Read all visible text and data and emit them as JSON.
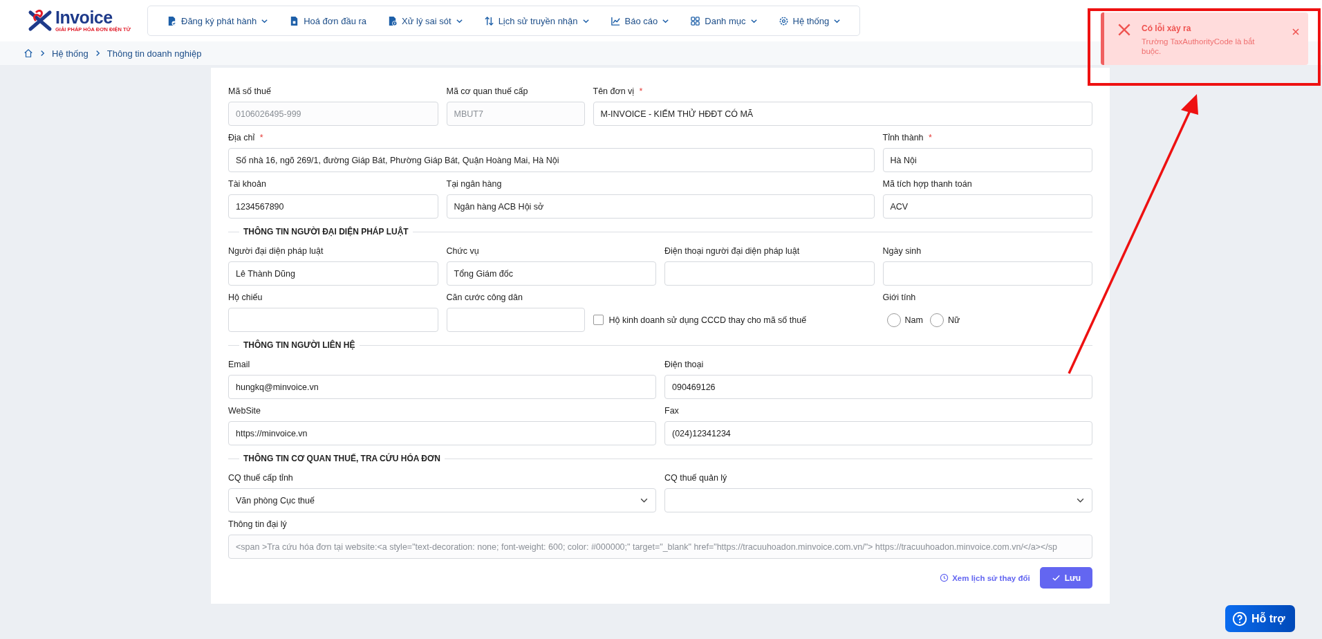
{
  "logo": {
    "brand": "Invoice",
    "tagline": "GIẢI PHÁP HÓA ĐƠN ĐIỆN TỬ"
  },
  "nav": [
    {
      "label": "Đăng ký phát hành",
      "dropdown": true
    },
    {
      "label": "Hoá đơn đầu ra",
      "dropdown": false
    },
    {
      "label": "Xử lý sai sót",
      "dropdown": true
    },
    {
      "label": "Lịch sử truyền nhận",
      "dropdown": true
    },
    {
      "label": "Báo cáo",
      "dropdown": true
    },
    {
      "label": "Danh mục",
      "dropdown": true
    },
    {
      "label": "Hệ thống",
      "dropdown": true
    }
  ],
  "breadcrumb": [
    "Hệ thống",
    "Thông tin doanh nghiệp"
  ],
  "sections": [
    {
      "rows": [
        [
          {
            "kind": "text",
            "label": "Mã số thuế",
            "value": "0106026495-999",
            "disabled": true
          },
          {
            "kind": "text",
            "label": "Mã cơ quan thuế cấp",
            "value": "MBUT7",
            "disabled": true
          },
          {
            "kind": "text",
            "label": "Tên đơn vị",
            "required_mark": "*",
            "value": "M-INVOICE - KIẾM THỬ HĐĐT CÓ MÃ",
            "disabled": false
          }
        ],
        [
          {
            "kind": "text",
            "label": "Địa chỉ",
            "required_mark": "*",
            "value": "Số nhà 16, ngõ 269/1, đường Giáp Bát, Phường Giáp Bát, Quận Hoàng Mai, Hà Nội",
            "disabled": false
          },
          {
            "kind": "text",
            "label": "Tỉnh thành",
            "required_mark": "*",
            "value": "Hà Nội",
            "disabled": false
          }
        ],
        [
          {
            "kind": "text",
            "label": "Tài khoản",
            "value": "1234567890",
            "disabled": false
          },
          {
            "kind": "text",
            "label": "Tại ngân hàng",
            "value": "Ngân hàng ACB Hội sở",
            "disabled": false
          },
          {
            "kind": "text",
            "label": "Mã tích hợp thanh toán",
            "value": "ACV",
            "disabled": false
          }
        ]
      ]
    },
    {
      "heading": "THÔNG TIN NGƯỜI ĐẠI DIỆN PHÁP LUẬT",
      "rows": [
        [
          {
            "kind": "text",
            "label": "Người đại diện pháp luật",
            "value": "Lê Thành Dũng",
            "disabled": false
          },
          {
            "kind": "text",
            "label": "Chức vụ",
            "value": "Tổng Giám đốc",
            "disabled": false
          },
          {
            "kind": "text",
            "label": "Điện thoại người đại diện pháp luật"
          },
          {
            "kind": "text",
            "label": "Ngày sinh"
          }
        ],
        [
          {
            "kind": "text",
            "label": "Hộ chiếu"
          },
          {
            "kind": "text",
            "label": "Căn cước công dân"
          },
          {
            "kind": "checkbox",
            "label": "Hộ kinh doanh sử dụng CCCD thay cho mã số thuế",
            "checked": false
          },
          {
            "kind": "radio",
            "label": "Giới tính",
            "options": [
              {
                "label": "Nam",
                "selected": false
              },
              {
                "label": "Nữ",
                "selected": false
              }
            ]
          }
        ]
      ]
    },
    {
      "heading": "THÔNG TIN NGƯỜI LIÊN HỆ",
      "rows": [
        [
          {
            "kind": "text",
            "label": "Email",
            "value": "hungkq@minvoice.vn",
            "disabled": false
          },
          {
            "kind": "text",
            "label": "Điện thoại",
            "value": "090469126",
            "disabled": false
          }
        ],
        [
          {
            "kind": "text",
            "label": "WebSite",
            "value": "https://minvoice.vn",
            "disabled": false
          },
          {
            "kind": "text",
            "label": "Fax",
            "value": "(024)12341234",
            "disabled": false
          }
        ]
      ]
    },
    {
      "heading": "THÔNG TIN CƠ QUAN THUẾ, TRA CỨU HÓA ĐƠN",
      "rows": [
        [
          {
            "kind": "select",
            "label": "CQ thuế cấp tỉnh",
            "value": "Văn phòng Cục thuế"
          },
          {
            "kind": "select",
            "label": "CQ thuế quản lý"
          }
        ],
        [
          {
            "kind": "text",
            "label": "Thông tin đại lý",
            "value": "<span >Tra cứu hóa đơn tại website:<a style=\"text-decoration: none; font-weight: 600; color: #000000;\" target=\"_blank\" href=\"https://tracuuhoadon.minvoice.com.vn/\"> https://tracuuhoadon.minvoice.com.vn/</a></sp",
            "disabled": true
          }
        ]
      ]
    }
  ],
  "actions": {
    "history_link": "Xem lịch sử thay đổi",
    "save_button": "Lưu"
  },
  "toast": {
    "title": "Có lỗi xảy ra",
    "message": "Trường TaxAuthorityCode là bắt buộc."
  },
  "help_button": "Hỗ trợ"
}
